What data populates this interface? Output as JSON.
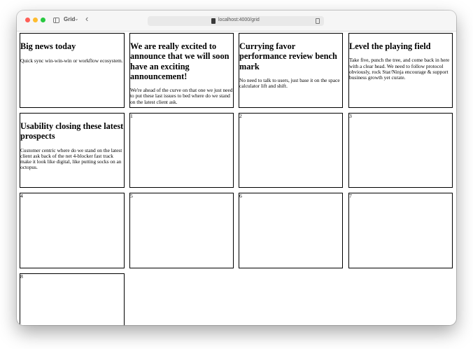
{
  "browser": {
    "tab_label": "Grid",
    "tab_chevron": "⌄",
    "back_label": "‹",
    "url": "localhost:4000/grid"
  },
  "cards": [
    {
      "title": "Big news today",
      "body": "Quick sync win-win-win or workflow ecosystem."
    },
    {
      "title": "We are really excited to announce that we will soon have an exciting announcement!",
      "body": "We're ahead of the curve on that one we just need to put these last issues to bed where do we stand on the latest client ask."
    },
    {
      "title": "Currying favor performance review bench mark",
      "body": "No need to talk to users, just base it on the space calculator lift and shift."
    },
    {
      "title": "Level the playing field",
      "body": "Take five, punch the tree, and come back in here with a clear head. We need to follow protocol obviously, rock Star/Ninja encourage & support business growth yet curate."
    },
    {
      "title": "Usability closing these latest prospects",
      "body": "Customer centric where do we stand on the latest client ask back of the net 4-blocker fast track make it look like digital, like putting socks on an octopus."
    }
  ],
  "numbered_cards": [
    "1",
    "2",
    "3",
    "4",
    "5",
    "6",
    "7",
    "8"
  ]
}
